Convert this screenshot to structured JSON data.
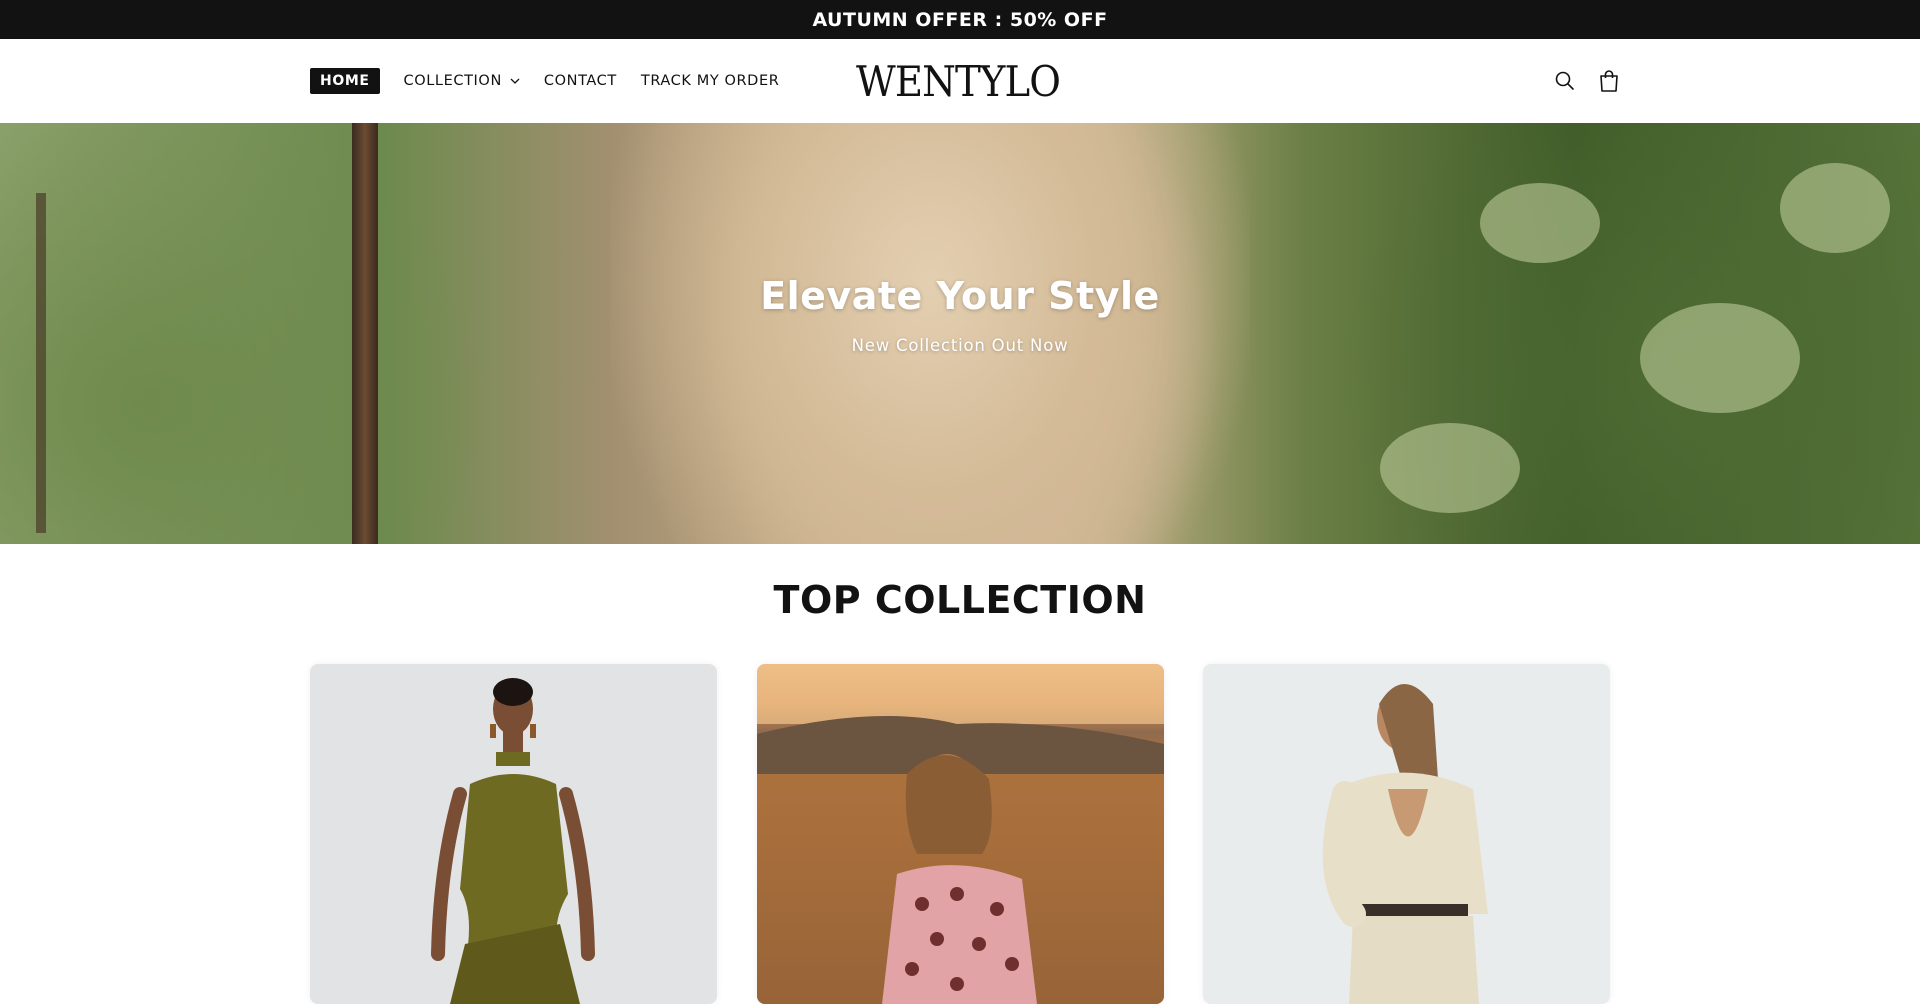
{
  "announcement": {
    "text": "AUTUMN OFFER : 50% OFF"
  },
  "header": {
    "nav": [
      {
        "label": "HOME",
        "active": true
      },
      {
        "label": "COLLECTION",
        "has_dropdown": true
      },
      {
        "label": "CONTACT"
      },
      {
        "label": "TRACK MY ORDER"
      }
    ],
    "logo": "WENTYLO",
    "icons": [
      "search-icon",
      "cart-icon"
    ]
  },
  "hero": {
    "title": "Elevate Your Style",
    "subtitle": "New Collection Out Now"
  },
  "section": {
    "title": "TOP COLLECTION",
    "cards": [
      {
        "image": "olive-dress-model"
      },
      {
        "image": "pink-polka-dot-dress-sunset"
      },
      {
        "image": "cream-backless-dress-model"
      }
    ]
  },
  "colors": {
    "announcement_bg": "#121212",
    "text": "#121212",
    "background": "#ffffff"
  }
}
